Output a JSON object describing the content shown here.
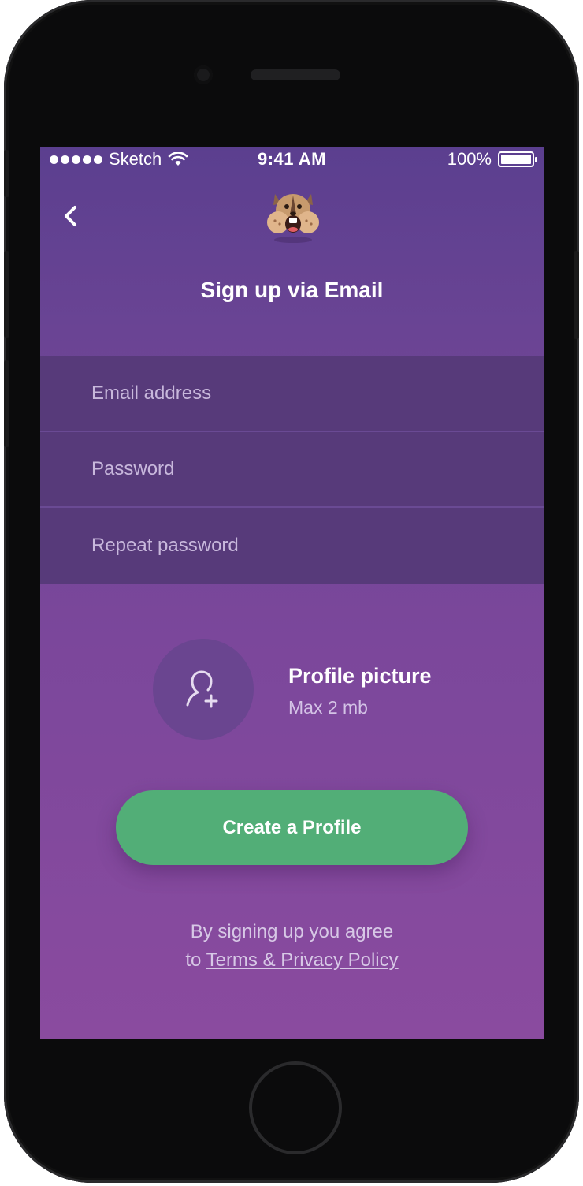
{
  "status_bar": {
    "carrier": "Sketch",
    "time": "9:41 AM",
    "battery": "100%",
    "battery_level": 1.0
  },
  "header": {
    "back_icon": "chevron-left-icon",
    "mascot_icon": "chipmunk-mascot-icon",
    "title": "Sign up via Email"
  },
  "form": {
    "email_placeholder": "Email address",
    "password_placeholder": "Password",
    "repeat_password_placeholder": "Repeat password"
  },
  "profile": {
    "icon": "add-user-icon",
    "label": "Profile picture",
    "sub_label": "Max 2 mb"
  },
  "cta": {
    "label": "Create a Profile"
  },
  "legal": {
    "line1": "By signing up you agree",
    "prefix": "to",
    "link": "Terms & Privacy Policy"
  },
  "colors": {
    "background_top": "#5b3f8f",
    "background_bottom": "#8a4b9f",
    "field_background": "#573a7a",
    "cta": "#52ae77"
  }
}
